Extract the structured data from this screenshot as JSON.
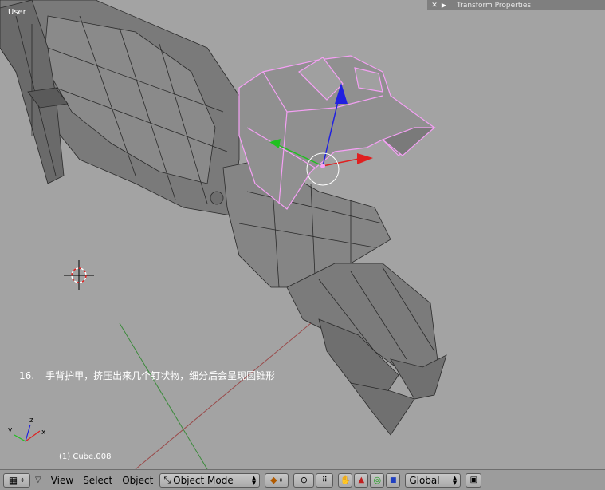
{
  "viewport": {
    "view_label": "User",
    "object_info": "(1) Cube.008",
    "caption_number": "16.",
    "caption_text": "手背护甲，挤压出来几个钉状物，细分后会呈现圆锥形"
  },
  "properties_panel": {
    "title": "Transform Properties",
    "close_icon": "x-icon",
    "collapse_icon": "triangle-right-icon"
  },
  "header": {
    "menus": [
      "View",
      "Select",
      "Object"
    ],
    "mode_label": "Object Mode",
    "orientation_label": "Global"
  },
  "colors": {
    "viewport_bg": "#a3a3a3",
    "selection": "#f5a0f5",
    "x_axis": "#e02020",
    "y_axis": "#20c020",
    "z_axis": "#2020e0"
  }
}
